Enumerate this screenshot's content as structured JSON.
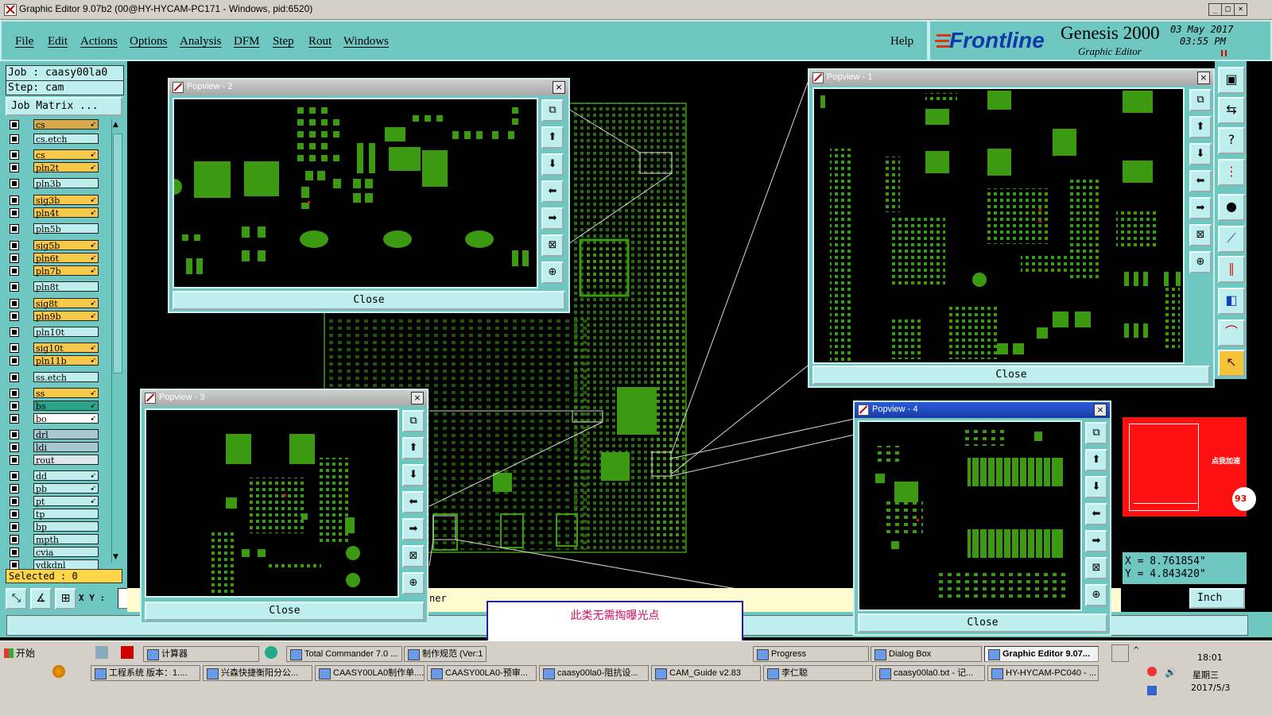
{
  "window": {
    "title": "Graphic Editor 9.07b2 (00@HY-HYCAM-PC171 - Windows, pid:6520)"
  },
  "menu": [
    "File",
    "Edit",
    "Actions",
    "Options",
    "Analysis",
    "DFM",
    "Step",
    "Rout",
    "Windows"
  ],
  "help_label": "Help",
  "brand": {
    "logo": "Frontline",
    "product": "Genesis 2000",
    "subtitle": "Graphic Editor",
    "date": "03 May 2017",
    "time": "03:55 PM"
  },
  "job": {
    "job_line": "Job : caasy00la0",
    "step_line": "Step: cam",
    "matrix_button": "Job Matrix ..."
  },
  "layers": [
    {
      "name": "cs",
      "color": "#d6a94a",
      "arrow": true
    },
    {
      "name": "cs.etch",
      "color": "#bfeeee",
      "arrow": false
    },
    {
      "name": "cs",
      "color": "#f7c84a",
      "arrow": true
    },
    {
      "name": "pln2t",
      "color": "#f7c84a",
      "arrow": true
    },
    {
      "name": "pln3b",
      "color": "#bfeeee",
      "arrow": false
    },
    {
      "name": "sig3b",
      "color": "#f7c84a",
      "arrow": true
    },
    {
      "name": "pln4t",
      "color": "#f7c84a",
      "arrow": true
    },
    {
      "name": "pln5b",
      "color": "#bfeeee",
      "arrow": false
    },
    {
      "name": "sig5b",
      "color": "#f7c84a",
      "arrow": true
    },
    {
      "name": "pln6t",
      "color": "#f7c84a",
      "arrow": true
    },
    {
      "name": "pln7b",
      "color": "#f7c84a",
      "arrow": true
    },
    {
      "name": "pln8t",
      "color": "#bfeeee",
      "arrow": false
    },
    {
      "name": "sig8t",
      "color": "#f7c84a",
      "arrow": true
    },
    {
      "name": "pln9b",
      "color": "#f7c84a",
      "arrow": true
    },
    {
      "name": "pln10t",
      "color": "#bfeeee",
      "arrow": false
    },
    {
      "name": "sig10t",
      "color": "#f7c84a",
      "arrow": true
    },
    {
      "name": "pln11b",
      "color": "#f7c84a",
      "arrow": true
    },
    {
      "name": "ss.etch",
      "color": "#bfeeee",
      "arrow": false
    },
    {
      "name": "ss",
      "color": "#f7c84a",
      "arrow": true
    },
    {
      "name": "bs",
      "color": "#2aa58a",
      "arrow": true
    },
    {
      "name": "bo",
      "color": "#ffffff",
      "arrow": true
    },
    {
      "name": "drl",
      "color": "#a8c8d0",
      "arrow": false
    },
    {
      "name": "ldi",
      "color": "#a8c8d0",
      "arrow": false
    },
    {
      "name": "rout",
      "color": "#dde6ea",
      "arrow": false
    },
    {
      "name": "dd",
      "color": "#bfeeee",
      "arrow": true
    },
    {
      "name": "pb",
      "color": "#bfeeee",
      "arrow": true
    },
    {
      "name": "pt",
      "color": "#bfeeee",
      "arrow": true
    },
    {
      "name": "tp",
      "color": "#bfeeee",
      "arrow": false
    },
    {
      "name": "bp",
      "color": "#bfeeee",
      "arrow": false
    },
    {
      "name": "mpth",
      "color": "#bfeeee",
      "arrow": false
    },
    {
      "name": "cvia",
      "color": "#bfeeee",
      "arrow": false
    },
    {
      "name": "vdkdnl",
      "color": "#bfeeee",
      "arrow": false
    }
  ],
  "selected": "Selected : 0",
  "xy_label": "X Y :",
  "status_tail": "ner",
  "popups": {
    "p1": {
      "title": "Popview - 1",
      "close": "Close"
    },
    "p2": {
      "title": "Popview - 2",
      "close": "Close"
    },
    "p3": {
      "title": "Popview - 3",
      "close": "Close"
    },
    "p4": {
      "title": "Popview - 4",
      "close": "Close"
    }
  },
  "coords": {
    "x": "X = 8.761854\"",
    "y": "Y = 4.843420\""
  },
  "units": "Inch",
  "overlay_badge": "点我加速",
  "overlay_num": "93",
  "annotation": "此类无需掏曝光点",
  "taskbar": {
    "start": "开始",
    "row1": [
      "计算器",
      "Total Commander 7.0 ...",
      "制作规范 (Ver:1",
      "Progress",
      "Dialog Box",
      "Graphic Editor 9.07..."
    ],
    "row2": [
      "工程系统  版本：1....",
      "兴森快捷衡阳分公...",
      "CAASY00LA0制作单....",
      "CAASY00LA0-预审...",
      "caasy00la0-阻抗设...",
      "CAM_Guide v2.83",
      "李仁聪",
      "caasy00la0.txt - 记...",
      "HY-HYCAM-PC040 - ..."
    ],
    "clock_time": "18:01",
    "clock_day": "星期三",
    "clock_date": "2017/5/3"
  }
}
